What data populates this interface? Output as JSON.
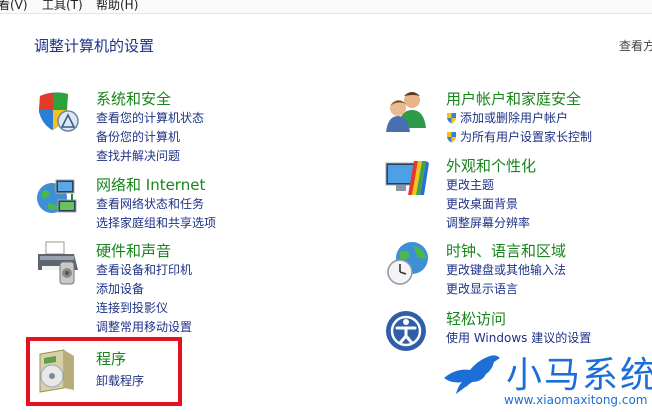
{
  "menubar": {
    "view": "看(V)",
    "tools": "工具(T)",
    "help": "帮助(H)"
  },
  "page_title": "调整计算机的设置",
  "view_by": "查看方",
  "categories": {
    "system": {
      "title": "系统和安全",
      "links": [
        "查看您的计算机状态",
        "备份您的计算机",
        "查找并解决问题"
      ]
    },
    "network": {
      "title": "网络和 Internet",
      "links": [
        "查看网络状态和任务",
        "选择家庭组和共享选项"
      ]
    },
    "hardware": {
      "title": "硬件和声音",
      "links": [
        "查看设备和打印机",
        "添加设备",
        "连接到投影仪",
        "调整常用移动设置"
      ]
    },
    "programs": {
      "title": "程序",
      "links": [
        "卸载程序"
      ]
    },
    "users": {
      "title": "用户帐户和家庭安全",
      "links": [
        "添加或删除用户帐户",
        "为所有用户设置家长控制"
      ]
    },
    "appearance": {
      "title": "外观和个性化",
      "links": [
        "更改主题",
        "更改桌面背景",
        "调整屏幕分辨率"
      ]
    },
    "clock": {
      "title": "时钟、语言和区域",
      "links": [
        "更改键盘或其他输入法",
        "更改显示语言"
      ]
    },
    "ease": {
      "title": "轻松访问",
      "links": [
        "使用 Windows 建议的设置"
      ]
    }
  },
  "watermark": {
    "brand": "小马系统",
    "url": "www.xiaomaxitong.com"
  },
  "colors": {
    "title_green": "#17851a",
    "link_blue": "#1e3287",
    "highlight_red": "#e5141b",
    "watermark_blue": "#1b6fd6"
  },
  "icons": {
    "system": "shield-icon",
    "network": "globe-network-icon",
    "hardware": "printer-icon",
    "programs": "program-box-icon",
    "users": "users-icon",
    "appearance": "monitor-palette-icon",
    "clock": "globe-clock-icon",
    "ease": "ease-of-access-icon"
  }
}
